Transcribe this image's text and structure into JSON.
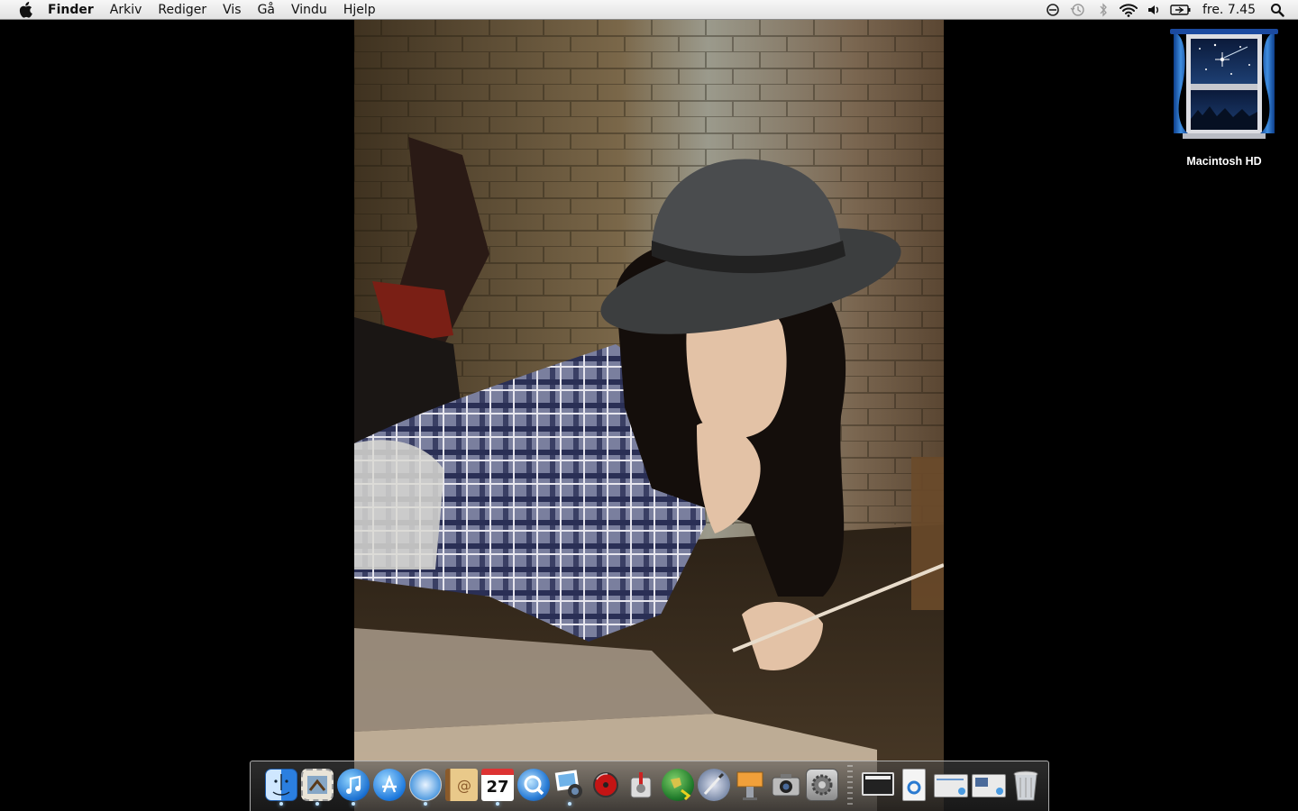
{
  "menubar": {
    "apple_icon": "apple-icon",
    "app_name": "Finder",
    "menus": [
      "Arkiv",
      "Rediger",
      "Vis",
      "Gå",
      "Vindu",
      "Hjelp"
    ],
    "status_icons": [
      "sync-icon",
      "time-machine-icon",
      "bluetooth-icon",
      "wifi-icon",
      "volume-icon",
      "battery-icon"
    ],
    "clock": "fre. 7.45",
    "spotlight_icon": "spotlight-search-icon"
  },
  "desktop": {
    "hd_label": "Macintosh HD"
  },
  "dock": {
    "apps": [
      {
        "name": "finder",
        "running": true
      },
      {
        "name": "mail",
        "running": true
      },
      {
        "name": "itunes",
        "running": true
      },
      {
        "name": "app-store",
        "running": false
      },
      {
        "name": "safari",
        "running": true
      },
      {
        "name": "address-book",
        "running": false
      },
      {
        "name": "ical",
        "running": true,
        "text": "27"
      },
      {
        "name": "quicktime",
        "running": false
      },
      {
        "name": "iphoto",
        "running": true
      },
      {
        "name": "dvd-player",
        "running": false
      },
      {
        "name": "instruments",
        "running": false
      },
      {
        "name": "network-globe",
        "running": false
      },
      {
        "name": "preview-editor",
        "running": false
      },
      {
        "name": "keynote",
        "running": false
      },
      {
        "name": "photo-booth",
        "running": false
      },
      {
        "name": "system-preferences",
        "running": false
      }
    ],
    "stacks": [
      "desktop-folder",
      "documents-file",
      "screenshot-stack-1",
      "screenshot-stack-2"
    ],
    "trash": "trash"
  },
  "colors": {
    "menubar": "#ebebeb",
    "desktop": "#000000",
    "running_dot": "#bfe3ff"
  }
}
